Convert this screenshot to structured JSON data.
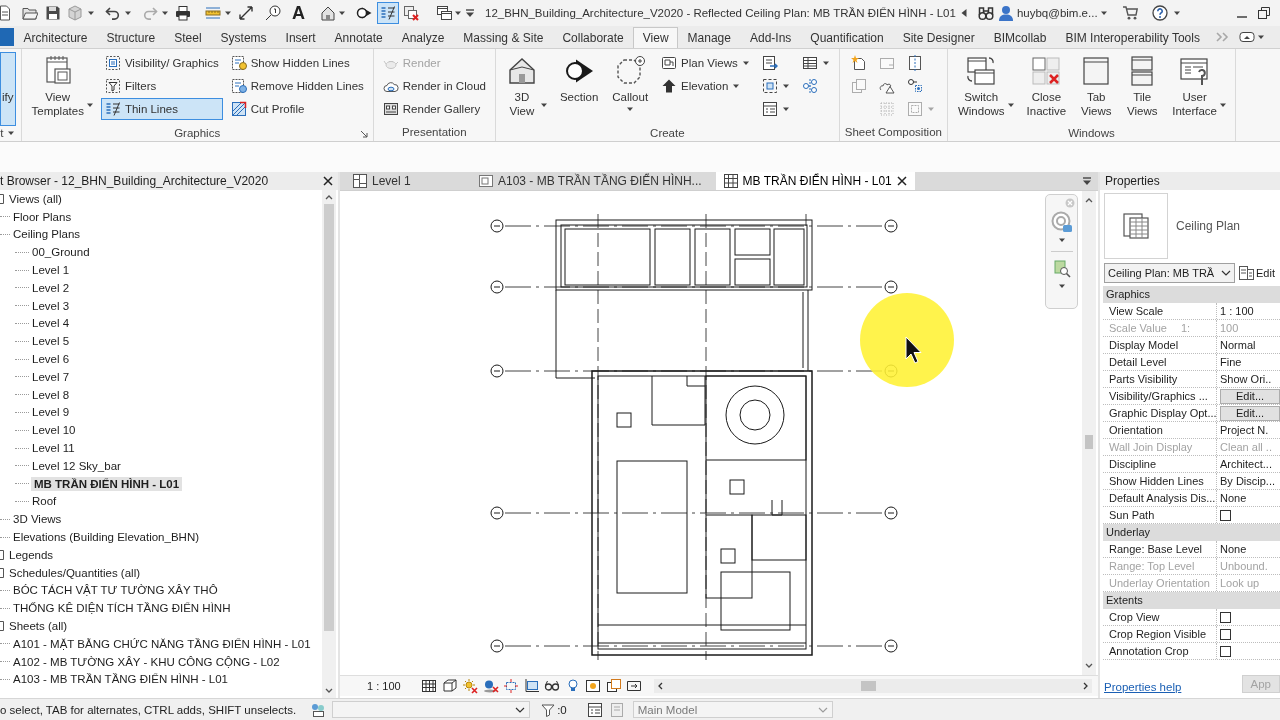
{
  "quick_access": {
    "text_tool": "A",
    "thin_lines": {
      "on": true
    }
  },
  "title_bar": {
    "title": "12_BHN_Building_Architecture_V2020 - Reflected Ceiling Plan: MB TRẦN ĐIỂN HÌNH - L01",
    "user": "huybq@bim.e..."
  },
  "ribbon_tabs": [
    {
      "label": "Architecture",
      "selected": false
    },
    {
      "label": "Structure",
      "selected": false
    },
    {
      "label": "Steel",
      "selected": false
    },
    {
      "label": "Systems",
      "selected": false
    },
    {
      "label": "Insert",
      "selected": false
    },
    {
      "label": "Annotate",
      "selected": false
    },
    {
      "label": "Analyze",
      "selected": false
    },
    {
      "label": "Massing & Site",
      "selected": false
    },
    {
      "label": "Collaborate",
      "selected": false
    },
    {
      "label": "View",
      "selected": true
    },
    {
      "label": "Manage",
      "selected": false
    },
    {
      "label": "Add-Ins",
      "selected": false
    },
    {
      "label": "Quantification",
      "selected": false
    },
    {
      "label": "Site Designer",
      "selected": false
    },
    {
      "label": "BIMcollab",
      "selected": false
    },
    {
      "label": "BIM Interoperability Tools",
      "selected": false
    }
  ],
  "ribbon_panels": [
    {
      "title": "t",
      "menu": true,
      "launcher": false,
      "columns": [
        [
          {
            "label": "ify",
            "kind": "large",
            "on": true,
            "disabled": false
          }
        ]
      ]
    },
    {
      "title": "Graphics",
      "menu": false,
      "launcher": true,
      "columns": [
        [
          {
            "label": "View Templates",
            "kind": "large-menu",
            "on": false,
            "disabled": false
          }
        ],
        [
          {
            "label": "Visibility/ Graphics",
            "kind": "small",
            "on": false,
            "disabled": false
          },
          {
            "label": "Filters",
            "kind": "small",
            "on": false,
            "disabled": false
          },
          {
            "label": "Thin Lines",
            "kind": "small",
            "on": true,
            "disabled": false
          }
        ],
        [
          {
            "label": "Show Hidden Lines",
            "kind": "small",
            "on": false,
            "disabled": false
          },
          {
            "label": "Remove Hidden Lines",
            "kind": "small",
            "on": false,
            "disabled": false
          },
          {
            "label": "Cut Profile",
            "kind": "small",
            "on": false,
            "disabled": false
          }
        ]
      ]
    },
    {
      "title": "Presentation",
      "menu": false,
      "launcher": false,
      "columns": [
        [
          {
            "label": "Render",
            "kind": "small",
            "on": false,
            "disabled": true
          },
          {
            "label": "Render in Cloud",
            "kind": "small",
            "on": false,
            "disabled": false
          },
          {
            "label": "Render Gallery",
            "kind": "small",
            "on": false,
            "disabled": false
          }
        ]
      ]
    },
    {
      "title": "Create",
      "menu": false,
      "launcher": false,
      "columns": [
        [
          {
            "label": "3D View",
            "kind": "large-menu",
            "on": false,
            "disabled": false
          }
        ],
        [
          {
            "label": "Section",
            "kind": "large",
            "on": false,
            "disabled": false
          }
        ],
        [
          {
            "label": "Callout",
            "kind": "large-split",
            "on": false,
            "disabled": false
          }
        ],
        [
          {
            "label": "Plan Views",
            "kind": "small-menu",
            "on": false,
            "disabled": false
          },
          {
            "label": "Elevation",
            "kind": "small-menu",
            "on": false,
            "disabled": false
          }
        ],
        [
          {
            "kind": "icon",
            "on": false,
            "disabled": false
          },
          {
            "kind": "icon-menu",
            "on": false,
            "disabled": false
          },
          {
            "kind": "icon-menu",
            "on": false,
            "disabled": false
          }
        ],
        [
          {
            "kind": "icon-menu",
            "on": false,
            "disabled": false
          },
          {
            "kind": "icon",
            "on": false,
            "disabled": false
          }
        ]
      ]
    },
    {
      "title": "Sheet Composition",
      "menu": false,
      "launcher": false,
      "columns": [
        [
          {
            "kind": "icon",
            "on": false,
            "disabled": false
          },
          {
            "kind": "icon",
            "on": false,
            "disabled": true
          }
        ],
        [
          {
            "kind": "icon",
            "on": false,
            "disabled": true
          },
          {
            "kind": "icon",
            "on": false,
            "disabled": false
          },
          {
            "kind": "icon",
            "on": false,
            "disabled": true
          }
        ],
        [
          {
            "kind": "icon",
            "on": false,
            "disabled": false
          },
          {
            "kind": "icon",
            "on": false,
            "disabled": false
          },
          {
            "kind": "icon-menu",
            "on": false,
            "disabled": true
          }
        ]
      ]
    },
    {
      "title": "Windows",
      "menu": false,
      "launcher": false,
      "columns": [
        [
          {
            "label": "Switch Windows",
            "kind": "large-menu",
            "on": false,
            "disabled": false
          }
        ],
        [
          {
            "label": "Close Inactive",
            "kind": "large",
            "on": false,
            "disabled": false
          }
        ],
        [
          {
            "label": "Tab Views",
            "kind": "large",
            "on": false,
            "disabled": false
          }
        ],
        [
          {
            "label": "Tile Views",
            "kind": "large",
            "on": false,
            "disabled": false
          }
        ],
        [
          {
            "label": "User Interface",
            "kind": "large-menu",
            "on": false,
            "disabled": false
          }
        ]
      ]
    }
  ],
  "project_browser": {
    "title": "t Browser - 12_BHN_Building_Architecture_V2020",
    "tree": [
      {
        "label": "Views (all)",
        "selected": false,
        "children": [
          {
            "label": "Floor Plans",
            "selected": false
          },
          {
            "label": "Ceiling Plans",
            "selected": false,
            "children": [
              {
                "label": "00_Ground",
                "selected": false
              },
              {
                "label": "Level 1",
                "selected": false
              },
              {
                "label": "Level 2",
                "selected": false
              },
              {
                "label": "Level 3",
                "selected": false
              },
              {
                "label": "Level 4",
                "selected": false
              },
              {
                "label": "Level 5",
                "selected": false
              },
              {
                "label": "Level 6",
                "selected": false
              },
              {
                "label": "Level 7",
                "selected": false
              },
              {
                "label": "Level 8",
                "selected": false
              },
              {
                "label": "Level 9",
                "selected": false
              },
              {
                "label": "Level 10",
                "selected": false
              },
              {
                "label": "Level 11",
                "selected": false
              },
              {
                "label": "Level 12 Sky_bar",
                "selected": false
              },
              {
                "label": "MB TRẦN ĐIỂN HÌNH - L01",
                "selected": true
              },
              {
                "label": "Roof",
                "selected": false
              }
            ]
          },
          {
            "label": "3D Views",
            "selected": false
          },
          {
            "label": "Elevations (Building Elevation_BHN)",
            "selected": false
          }
        ]
      },
      {
        "label": "Legends",
        "selected": false
      },
      {
        "label": "Schedules/Quantities (all)",
        "selected": false,
        "children": [
          {
            "label": "BÓC TÁCH VẬT TƯ TƯỜNG XÂY THÔ",
            "selected": false
          },
          {
            "label": "THỐNG KÊ DIỆN TÍCH TẦNG ĐIỂN HÌNH",
            "selected": false
          }
        ]
      },
      {
        "label": "Sheets (all)",
        "selected": false,
        "children": [
          {
            "label": "A101 - MẶT BẰNG CHỨC NĂNG TẦNG ĐIỂN HÌNH - L01",
            "selected": false
          },
          {
            "label": "A102 - MB TƯỜNG XÂY - KHU CÔNG CỘNG - L02",
            "selected": false
          },
          {
            "label": "A103 - MB TRẦN TẦNG ĐIỂN HÌNH - L01",
            "selected": false
          }
        ]
      }
    ]
  },
  "view_tabs": [
    {
      "label": "Level 1",
      "selected": false
    },
    {
      "label": "A103 - MB TRẦN TẦNG ĐIỂN HÌNH...",
      "selected": false
    },
    {
      "label": "MB TRẦN ĐIỂN HÌNH - L01",
      "selected": true
    }
  ],
  "view_control_bar": {
    "scale": "1 : 100"
  },
  "properties": {
    "title": "Properties",
    "type_name": "Ceiling Plan",
    "type_selector": "Ceiling Plan: MB TRẦ",
    "edit_type": "Edit",
    "groups": [
      {
        "name": "Graphics",
        "rows": [
          {
            "label": "View Scale",
            "value": "1 : 100",
            "kind": "text",
            "disabled": false
          },
          {
            "label": "Scale Value",
            "suffix": "1:",
            "value": "100",
            "kind": "text",
            "disabled": true
          },
          {
            "label": "Display Model",
            "value": "Normal",
            "kind": "text",
            "disabled": false
          },
          {
            "label": "Detail Level",
            "value": "Fine",
            "kind": "text",
            "disabled": false
          },
          {
            "label": "Parts Visibility",
            "value": "Show Ori..",
            "kind": "text",
            "disabled": false
          },
          {
            "label": "Visibility/Graphics ...",
            "value": "Edit...",
            "kind": "button",
            "disabled": false
          },
          {
            "label": "Graphic Display Opt...",
            "value": "Edit...",
            "kind": "button",
            "disabled": false
          },
          {
            "label": "Orientation",
            "value": "Project N.",
            "kind": "text",
            "disabled": false
          },
          {
            "label": "Wall Join Display",
            "value": "Clean all ..",
            "kind": "text",
            "disabled": true
          },
          {
            "label": "Discipline",
            "value": "Architect...",
            "kind": "text",
            "disabled": false
          },
          {
            "label": "Show Hidden Lines",
            "value": "By Discip...",
            "kind": "text",
            "disabled": false
          },
          {
            "label": "Default Analysis Dis...",
            "value": "None",
            "kind": "text",
            "disabled": false
          },
          {
            "label": "Sun Path",
            "kind": "checkbox",
            "checked": false,
            "disabled": false
          }
        ]
      },
      {
        "name": "Underlay",
        "rows": [
          {
            "label": "Range: Base Level",
            "value": "None",
            "kind": "text",
            "disabled": false
          },
          {
            "label": "Range: Top Level",
            "value": "Unbound.",
            "kind": "text",
            "disabled": true
          },
          {
            "label": "Underlay Orientation",
            "value": "Look up",
            "kind": "text",
            "disabled": true
          }
        ]
      },
      {
        "name": "Extents",
        "rows": [
          {
            "label": "Crop View",
            "kind": "checkbox",
            "checked": false,
            "disabled": false
          },
          {
            "label": "Crop Region Visible",
            "kind": "checkbox",
            "checked": false,
            "disabled": false
          },
          {
            "label": "Annotation Crop",
            "kind": "checkbox",
            "checked": false,
            "disabled": false
          }
        ]
      }
    ],
    "help_link": "Properties help",
    "apply": {
      "label": "App",
      "disabled": true
    }
  },
  "status_bar": {
    "message": "o select, TAB for alternates, CTRL adds, SHIFT unselects.",
    "filter_count": ":0",
    "design_option": {
      "value": "Main Model",
      "disabled": true
    }
  }
}
